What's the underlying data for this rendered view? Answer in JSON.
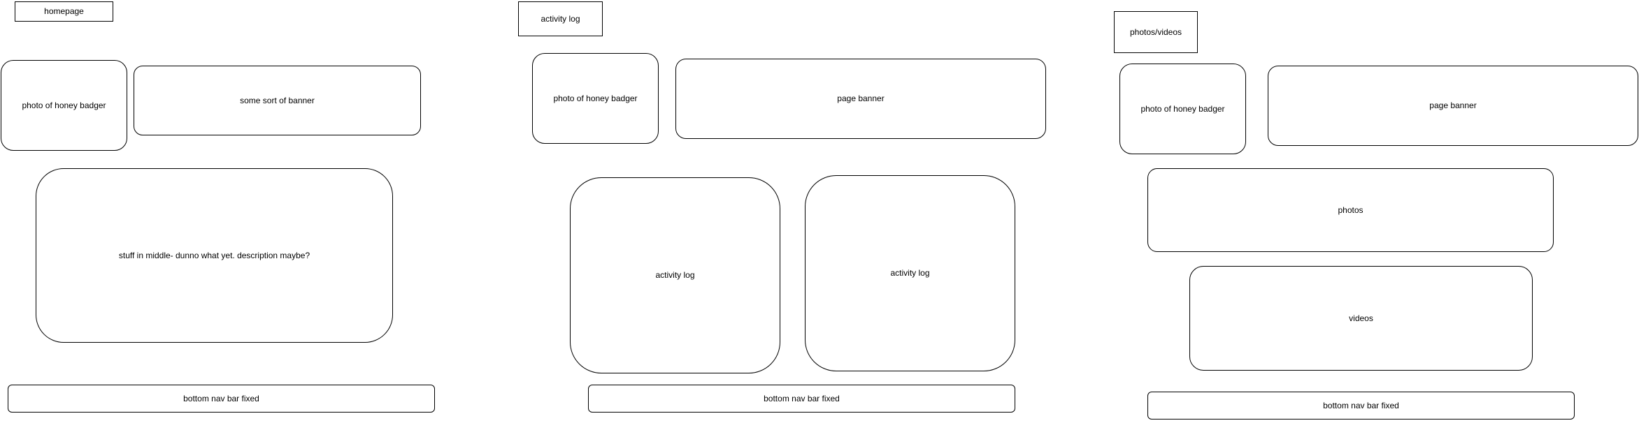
{
  "pages": [
    {
      "title": "homepage",
      "boxes": {
        "photo": "photo of honey badger",
        "banner": "some sort of banner",
        "middle": "stuff in middle- dunno what yet. description maybe?",
        "nav": "bottom nav bar fixed"
      }
    },
    {
      "title": "activity log",
      "boxes": {
        "photo": "photo of honey badger",
        "banner": "page banner",
        "activity_left": "activity log",
        "activity_right": "activity log",
        "nav": "bottom nav bar fixed"
      }
    },
    {
      "title": "photos/videos",
      "boxes": {
        "photo": "photo of honey badger",
        "banner": "page banner",
        "photos": "photos",
        "videos": "videos",
        "nav": "bottom nav bar fixed"
      }
    }
  ]
}
